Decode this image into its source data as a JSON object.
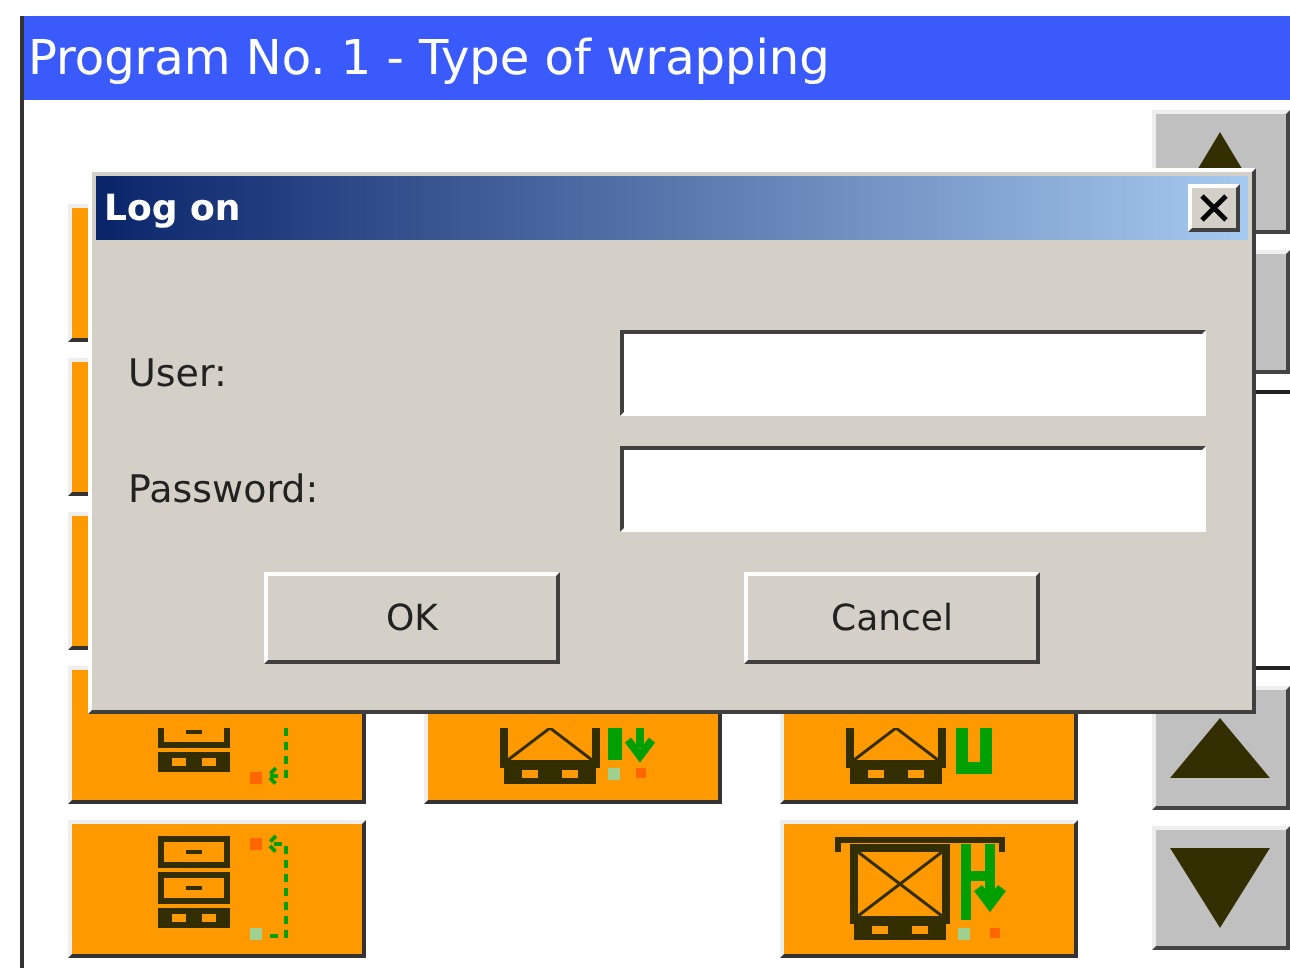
{
  "window": {
    "title": "Program No. 1 - Type of wrapping"
  },
  "tiles": [
    {
      "kind": "covered"
    },
    {
      "kind": "empty"
    },
    {
      "kind": "empty"
    },
    {
      "kind": "covered"
    },
    {
      "kind": "empty"
    },
    {
      "kind": "empty"
    },
    {
      "kind": "covered"
    },
    {
      "kind": "empty"
    },
    {
      "kind": "empty"
    },
    {
      "kind": "stack-down"
    },
    {
      "kind": "box-down"
    },
    {
      "kind": "box-loop"
    },
    {
      "kind": "stack-up"
    },
    {
      "kind": "empty"
    },
    {
      "kind": "box-hood"
    }
  ],
  "nav": [
    {
      "kind": "up-double"
    },
    {
      "kind": "plain"
    },
    {
      "kind": "panel"
    },
    {
      "kind": "up"
    },
    {
      "kind": "down"
    }
  ],
  "dialog": {
    "title": "Log on",
    "fields": [
      {
        "label": "User:"
      },
      {
        "label": "Password:"
      }
    ],
    "buttons": [
      "OK",
      "Cancel"
    ]
  }
}
